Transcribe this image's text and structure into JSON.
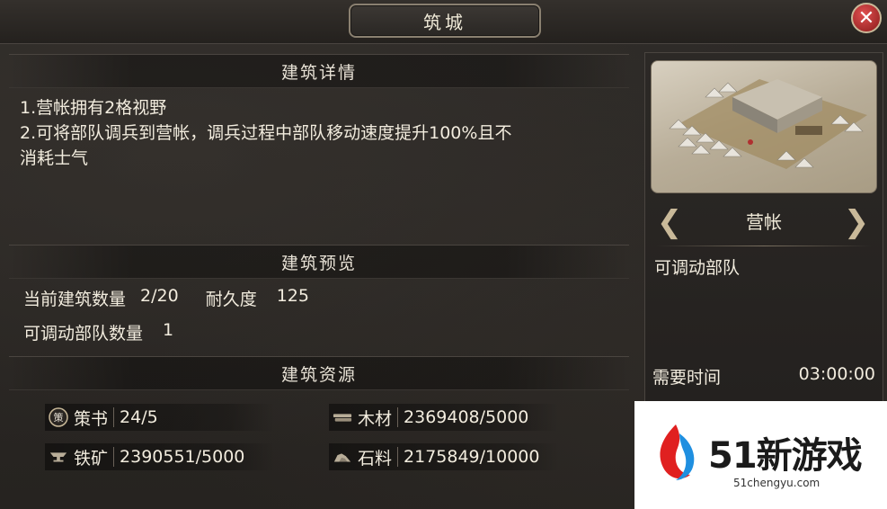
{
  "window": {
    "title": "筑城"
  },
  "close_label": "✕",
  "details": {
    "header": "建筑详情",
    "line1": "1.营帐拥有2格视野",
    "line2": "2.可将部队调兵到营帐，调兵过程中部队移动速度提升100%且不",
    "line3": "消耗士气"
  },
  "preview": {
    "header": "建筑预览",
    "count_label": "当前建筑数量",
    "count_value": "2/20",
    "durability_label": "耐久度",
    "durability_value": "125",
    "troops_label": "可调动部队数量",
    "troops_value": "1"
  },
  "resources": {
    "header": "建筑资源",
    "items": [
      {
        "name": "策书",
        "value": "24/5",
        "icon": "strategy-book-icon"
      },
      {
        "name": "木材",
        "value": "2369408/5000",
        "icon": "wood-icon"
      },
      {
        "name": "铁矿",
        "value": "2390551/5000",
        "icon": "iron-anvil-icon"
      },
      {
        "name": "石料",
        "value": "2175849/10000",
        "icon": "stone-icon"
      }
    ],
    "book_glyph": "策"
  },
  "building": {
    "name": "营帐",
    "description": "可调动部队",
    "time_label": "需要时间",
    "time_value": "03:00:00",
    "prev_arrow": "❮",
    "next_arrow": "❯"
  },
  "watermark": {
    "brand": "51新游戏",
    "url": "51chengyu.com"
  },
  "colors": {
    "background": "#2a2724",
    "text": "#f2ecde",
    "accent_gold": "#c9b999",
    "close_red": "#c03030"
  }
}
